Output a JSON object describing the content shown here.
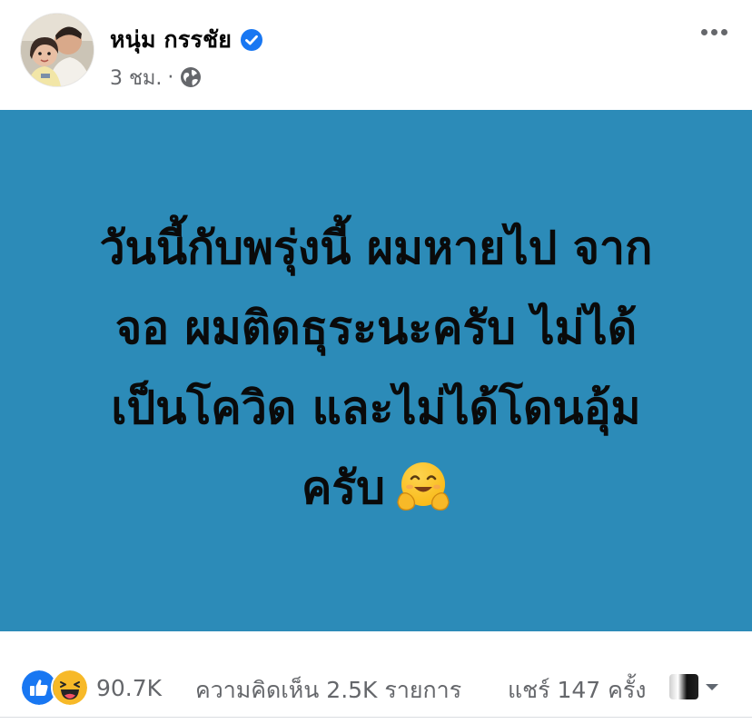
{
  "post": {
    "author": {
      "name": "หนุ่ม กรรชัย",
      "verified": true,
      "avatar_icon": "profile-photo"
    },
    "meta": {
      "time": "3 ชม.",
      "separator": "·",
      "audience_icon": "globe-icon"
    },
    "more_icon": "more-horizontal-icon",
    "card": {
      "background_color": "#2c8bb8",
      "lines": [
        "วันนี้กับพรุ่งนี้ ผมหายไป จาก",
        "จอ ผมติดธุระนะครับ ไม่ได้",
        "เป็นโควิด และไม่ได้โดนอุ้ม",
        "ครับ"
      ],
      "emoji": "hugging-face"
    },
    "stats": {
      "reaction_icons": [
        "like-icon",
        "haha-icon"
      ],
      "reaction_count": "90.7K",
      "comments": "ความคิดเห็น 2.5K รายการ",
      "shares": "แชร์ 147 ครั้ง"
    },
    "colors": {
      "verified_blue": "#1877f2",
      "meta_gray": "#65676b",
      "like_blue": "#1877f2",
      "haha_yellow": "#f7b928"
    }
  }
}
